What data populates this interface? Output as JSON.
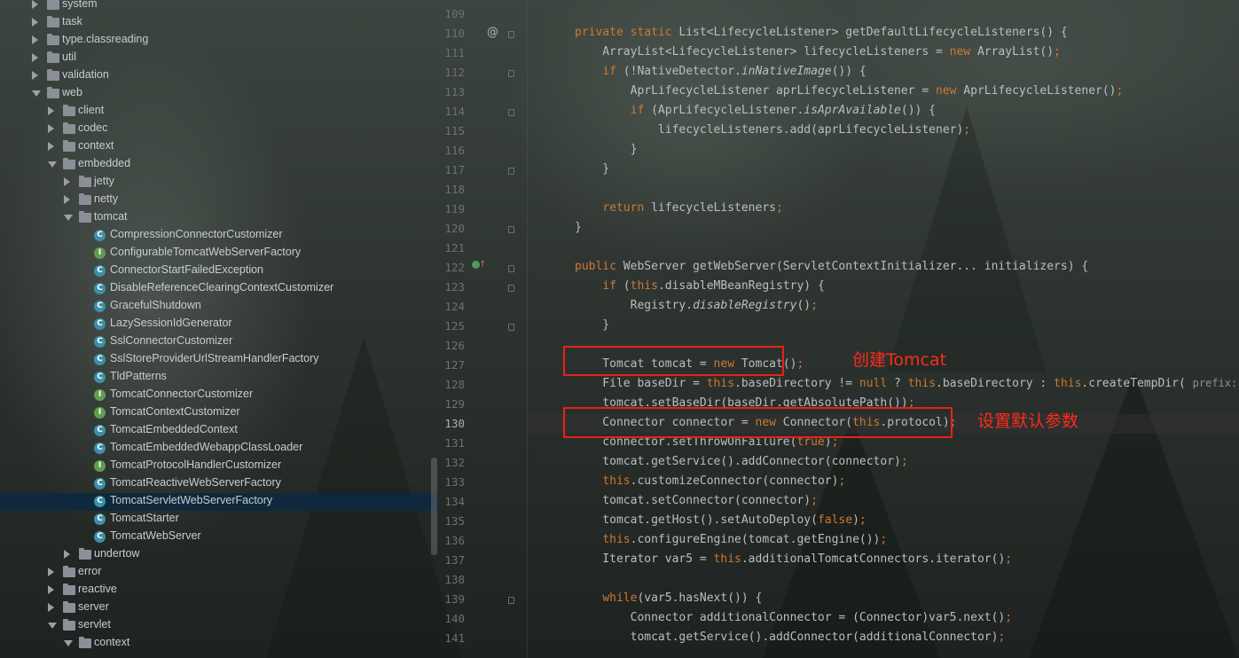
{
  "tree": [
    {
      "label": "system",
      "indent": 0,
      "kind": "folder",
      "state": "collapsed"
    },
    {
      "label": "task",
      "indent": 0,
      "kind": "folder",
      "state": "collapsed"
    },
    {
      "label": "type.classreading",
      "indent": 0,
      "kind": "folder",
      "state": "collapsed"
    },
    {
      "label": "util",
      "indent": 0,
      "kind": "folder",
      "state": "collapsed"
    },
    {
      "label": "validation",
      "indent": 0,
      "kind": "folder",
      "state": "collapsed"
    },
    {
      "label": "web",
      "indent": 0,
      "kind": "folder",
      "state": "expanded"
    },
    {
      "label": "client",
      "indent": 1,
      "kind": "folder",
      "state": "collapsed"
    },
    {
      "label": "codec",
      "indent": 1,
      "kind": "folder",
      "state": "collapsed"
    },
    {
      "label": "context",
      "indent": 1,
      "kind": "folder",
      "state": "collapsed"
    },
    {
      "label": "embedded",
      "indent": 1,
      "kind": "folder",
      "state": "expanded"
    },
    {
      "label": "jetty",
      "indent": 2,
      "kind": "folder",
      "state": "collapsed"
    },
    {
      "label": "netty",
      "indent": 2,
      "kind": "folder",
      "state": "collapsed"
    },
    {
      "label": "tomcat",
      "indent": 2,
      "kind": "folder",
      "state": "expanded"
    },
    {
      "label": "CompressionConnectorCustomizer",
      "indent": 3,
      "kind": "class"
    },
    {
      "label": "ConfigurableTomcatWebServerFactory",
      "indent": 3,
      "kind": "interface"
    },
    {
      "label": "ConnectorStartFailedException",
      "indent": 3,
      "kind": "class"
    },
    {
      "label": "DisableReferenceClearingContextCustomizer",
      "indent": 3,
      "kind": "class"
    },
    {
      "label": "GracefulShutdown",
      "indent": 3,
      "kind": "class"
    },
    {
      "label": "LazySessionIdGenerator",
      "indent": 3,
      "kind": "class"
    },
    {
      "label": "SslConnectorCustomizer",
      "indent": 3,
      "kind": "class"
    },
    {
      "label": "SslStoreProviderUrlStreamHandlerFactory",
      "indent": 3,
      "kind": "class"
    },
    {
      "label": "TldPatterns",
      "indent": 3,
      "kind": "class"
    },
    {
      "label": "TomcatConnectorCustomizer",
      "indent": 3,
      "kind": "interface"
    },
    {
      "label": "TomcatContextCustomizer",
      "indent": 3,
      "kind": "interface"
    },
    {
      "label": "TomcatEmbeddedContext",
      "indent": 3,
      "kind": "class"
    },
    {
      "label": "TomcatEmbeddedWebappClassLoader",
      "indent": 3,
      "kind": "class"
    },
    {
      "label": "TomcatProtocolHandlerCustomizer",
      "indent": 3,
      "kind": "interface"
    },
    {
      "label": "TomcatReactiveWebServerFactory",
      "indent": 3,
      "kind": "class"
    },
    {
      "label": "TomcatServletWebServerFactory",
      "indent": 3,
      "kind": "class",
      "selected": true
    },
    {
      "label": "TomcatStarter",
      "indent": 3,
      "kind": "class"
    },
    {
      "label": "TomcatWebServer",
      "indent": 3,
      "kind": "class"
    },
    {
      "label": "undertow",
      "indent": 2,
      "kind": "folder",
      "state": "collapsed"
    },
    {
      "label": "error",
      "indent": 1,
      "kind": "folder",
      "state": "collapsed"
    },
    {
      "label": "reactive",
      "indent": 1,
      "kind": "folder",
      "state": "collapsed"
    },
    {
      "label": "server",
      "indent": 1,
      "kind": "folder",
      "state": "collapsed"
    },
    {
      "label": "servlet",
      "indent": 1,
      "kind": "folder",
      "state": "expanded"
    },
    {
      "label": "context",
      "indent": 2,
      "kind": "folder",
      "state": "expanded"
    }
  ],
  "editor": {
    "line_numbers": [
      "109",
      "110",
      "111",
      "112",
      "113",
      "114",
      "115",
      "116",
      "117",
      "118",
      "119",
      "120",
      "121",
      "122",
      "123",
      "124",
      "125",
      "126",
      "127",
      "128",
      "129",
      "130",
      "131",
      "132",
      "133",
      "134",
      "135",
      "136",
      "137",
      "138",
      "139",
      "140",
      "141"
    ],
    "current_line": "130",
    "gutter_annotation": "@",
    "lines": [
      "",
      "<span class=\"k\">private static</span> List&lt;LifecycleListener&gt; getDefaultLifecycleListeners() {",
      "    ArrayList&lt;LifecycleListener&gt; lifecycleListeners = <span class=\"k\">new</span> ArrayList()<span class=\"k\">;</span>",
      "    <span class=\"k\">if</span> (!NativeDetector.<i>inNativeImage</i>()) {",
      "        AprLifecycleListener aprLifecycleListener = <span class=\"k\">new</span> AprLifecycleListener()<span class=\"k\">;</span>",
      "        <span class=\"k\">if</span> (AprLifecycleListener.<i>isAprAvailable</i>()) {",
      "            lifecycleListeners.add(aprLifecycleListener)<span class=\"k\">;</span>",
      "        }",
      "    }",
      "",
      "    <span class=\"k\">return</span> lifecycleListeners<span class=\"k\">;</span>",
      "}",
      "",
      "<span class=\"k\">public</span> WebServer getWebServer(ServletContextInitializer... initializers) {",
      "    <span class=\"k\">if</span> (<span class=\"k\">this</span>.disableMBeanRegistry) {",
      "        Registry.<i>disableRegistry</i>()<span class=\"k\">;</span>",
      "    }",
      "",
      "    Tomcat tomcat = <span class=\"k\">new</span> Tomcat()<span class=\"k\">;</span>",
      "    File baseDir = <span class=\"k\">this</span>.baseDirectory != <span class=\"k\">null</span> ? <span class=\"k\">this</span>.baseDirectory : <span class=\"k\">this</span>.createTempDir( <span class=\"hint\">prefix:</span> <span class=\"s\">\"to</span>",
      "    tomcat.setBaseDir(baseDir.getAbsolutePath())<span class=\"k\">;</span>",
      "    Connector connector = <span class=\"k\">new</span> Connector(<span class=\"k\">this</span>.protocol)<span class=\"k\">;</span>",
      "    connector.setThrowOnFailure(<span class=\"k\">true</span>)<span class=\"k\">;</span>",
      "    tomcat.getService().addConnector(connector)<span class=\"k\">;</span>",
      "    <span class=\"k\">this</span>.customizeConnector(connector)<span class=\"k\">;</span>",
      "    tomcat.setConnector(connector)<span class=\"k\">;</span>",
      "    tomcat.getHost().setAutoDeploy(<span class=\"k\">false</span>)<span class=\"k\">;</span>",
      "    <span class=\"k\">this</span>.configureEngine(tomcat.getEngine())<span class=\"k\">;</span>",
      "    Iterator var5 = <span class=\"k\">this</span>.additionalTomcatConnectors.iterator()<span class=\"k\">;</span>",
      "",
      "    <span class=\"k\">while</span>(var5.hasNext()) {",
      "        Connector additionalConnector = (Connector)var5.next()<span class=\"k\">;</span>",
      "        tomcat.getService().addConnector(additionalConnector)<span class=\"k\">;</span>"
    ]
  },
  "annotations": {
    "create_tomcat": "创建Tomcat",
    "set_defaults": "设置默认参数"
  }
}
